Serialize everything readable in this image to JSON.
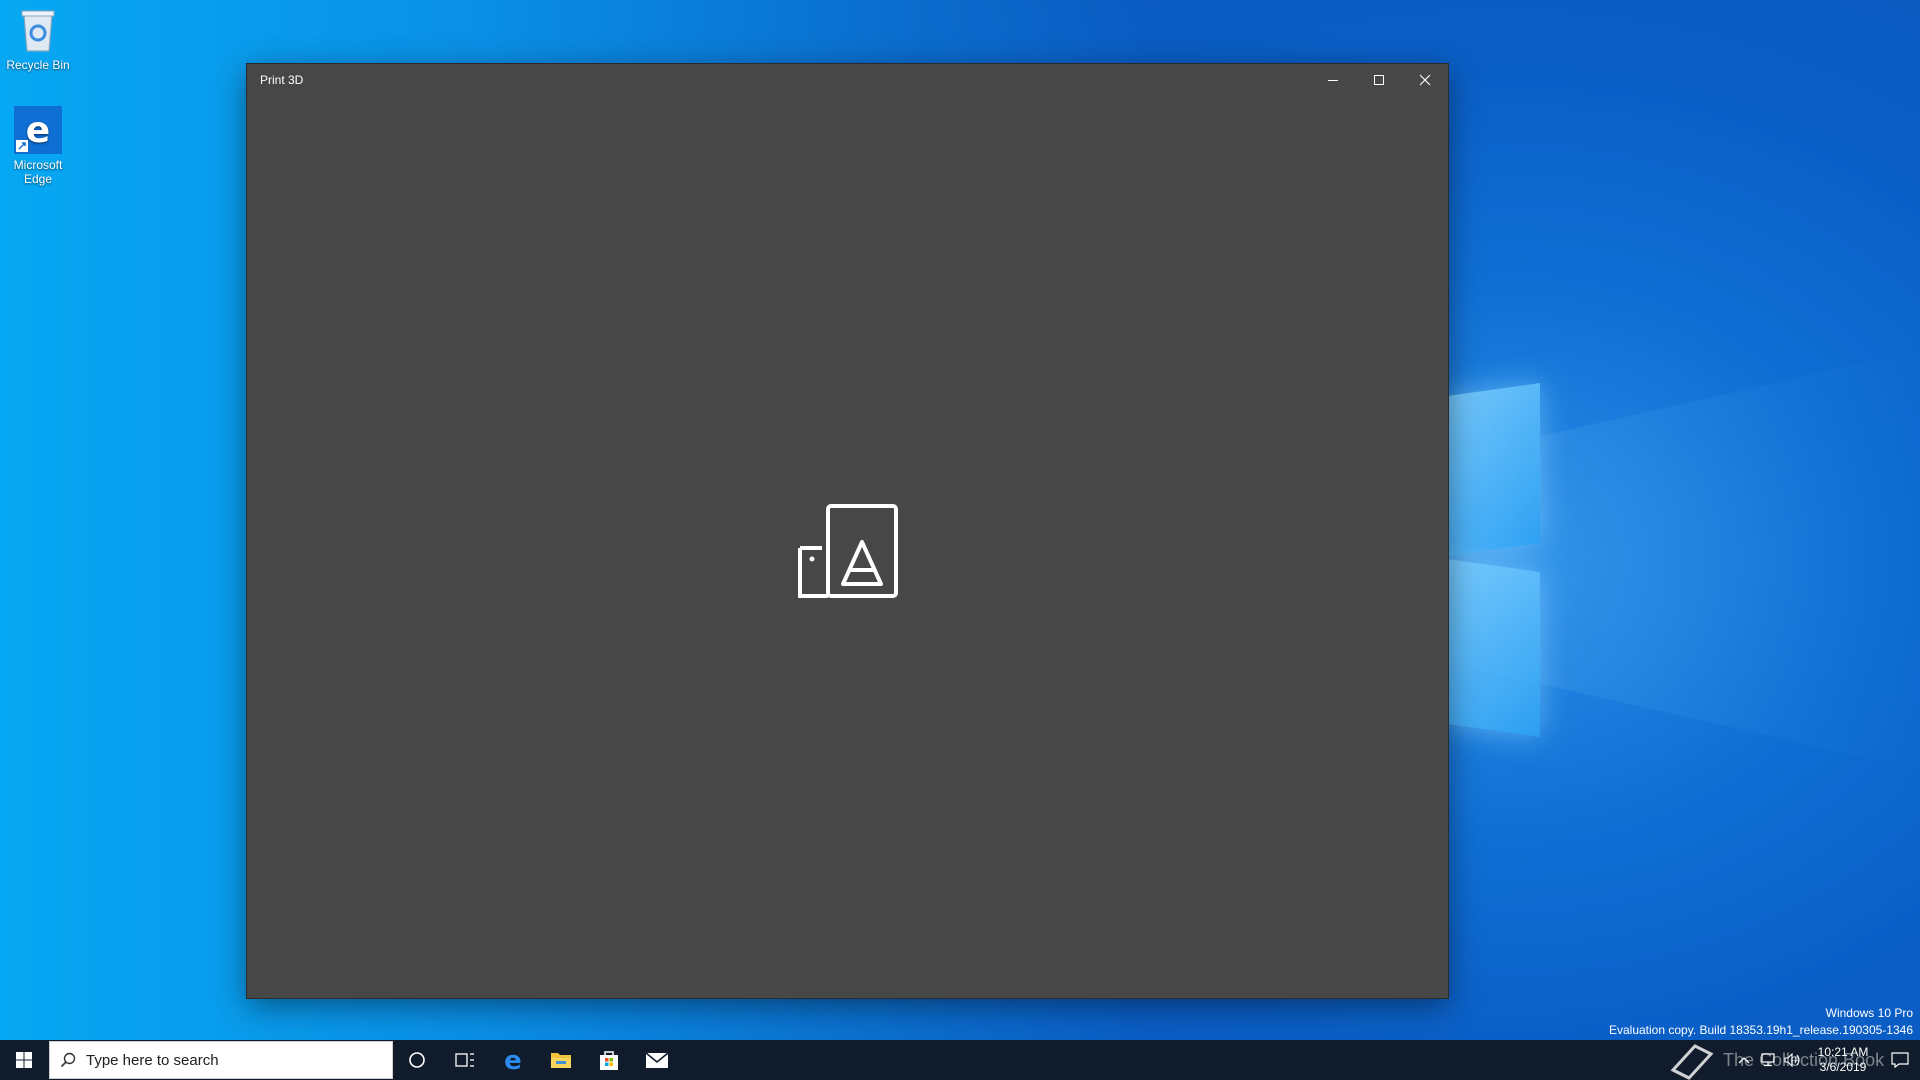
{
  "desktop": {
    "icons": [
      {
        "label": "Recycle Bin",
        "icon": "recycle-bin-icon"
      },
      {
        "label": "Microsoft Edge",
        "icon": "edge-icon"
      }
    ],
    "watermark": {
      "line1": "Windows 10 Pro",
      "line2": "Evaluation copy. Build 18353.19h1_release.190305-1346"
    }
  },
  "window": {
    "title": "Print 3D",
    "controls": {
      "minimize": "minimize-icon",
      "maximize": "maximize-icon",
      "close": "close-icon"
    },
    "splash_icon": "print-3d-icon",
    "background": "#474747"
  },
  "taskbar": {
    "search_placeholder": "Type here to search",
    "pinned": [
      "cortana-icon",
      "task-view-icon",
      "edge-icon",
      "file-explorer-icon",
      "store-icon",
      "mail-icon"
    ],
    "brand_text": "The Collection Book",
    "clock": {
      "time": "10:21 AM",
      "date": "3/6/2019"
    },
    "background": "#101c2b"
  }
}
